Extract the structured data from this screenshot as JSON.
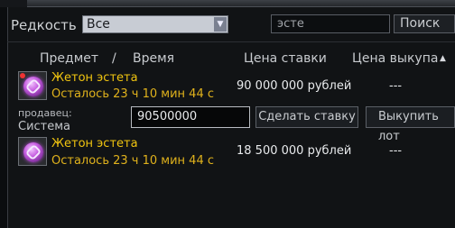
{
  "filter": {
    "rarity_label": "Редкость",
    "rarity_value": "Все"
  },
  "search": {
    "value": "эсте",
    "button_label": "Поиск"
  },
  "columns": {
    "item": "Предмет",
    "separator": "/",
    "time": "Время",
    "bid_price": "Цена ставки",
    "buyout_price": "Цена выкупа"
  },
  "icons": {
    "rarity_dropdown": "chevron-down-icon",
    "sort_indicator": "sort-ascending-icon",
    "item_icon": "purple-chain-token-icon"
  },
  "lots": [
    {
      "name": "Жетон эстета",
      "time_left": "Осталось 23 ч 10 мин 44 с",
      "bid_price": "90 000 000 рублей",
      "buyout_price": "---",
      "expanded": true,
      "seller_label": "продавец:",
      "seller_name": "Система",
      "bid_input_value": "90500000",
      "bid_button_label": "Сделать ставку",
      "buyout_button_label": "Выкупить лот"
    },
    {
      "name": "Жетон эстета",
      "time_left": "Осталось 23 ч 10 мин 44 с",
      "bid_price": "18 500 000 рублей",
      "buyout_price": "---"
    }
  ],
  "colors": {
    "item_name": "#f0c410",
    "time_left": "#e0b21c",
    "background": "#111315"
  }
}
